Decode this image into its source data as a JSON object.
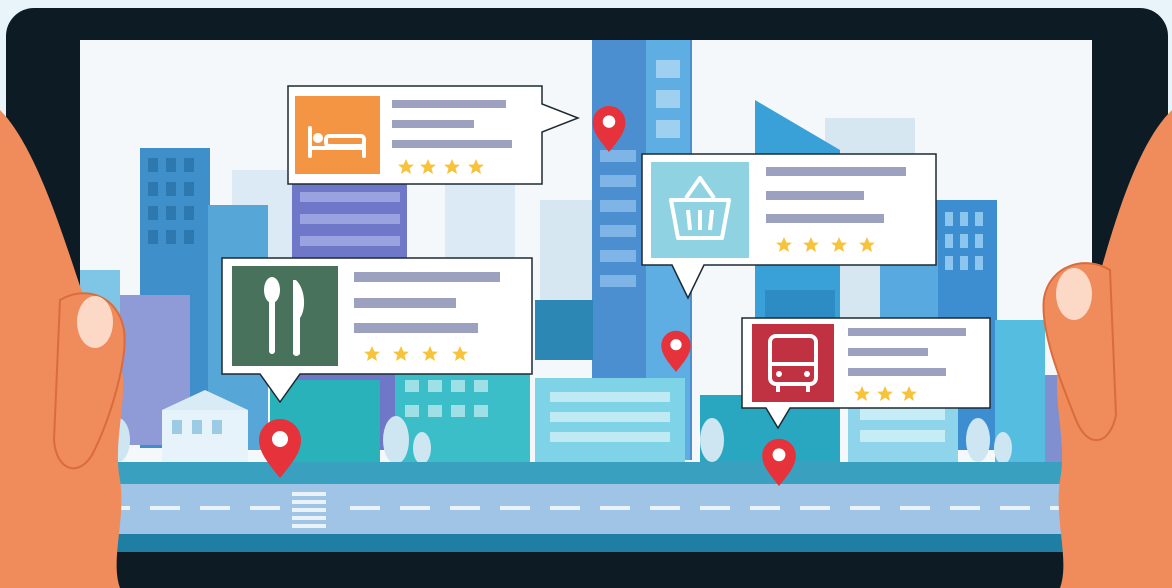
{
  "scene": {
    "title": "",
    "colors": {
      "frame": "#0d1b24",
      "sky": "#f4f8fb",
      "road": "#5aa9c6",
      "pin": "#e5323b",
      "star": "#f6c33a",
      "card_line": "#9ca1bf",
      "skin": "#f08b5b"
    }
  },
  "cards": [
    {
      "id": "hotel",
      "category": "hotel",
      "icon": "bed-icon",
      "icon_bg": "#f49543",
      "rating": 4
    },
    {
      "id": "shopping",
      "category": "shopping",
      "icon": "basket-icon",
      "icon_bg": "#8fd3e3",
      "rating": 4
    },
    {
      "id": "restaurant",
      "category": "restaurant",
      "icon": "fork-knife-icon",
      "icon_bg": "#48725b",
      "rating": 4
    },
    {
      "id": "transit",
      "category": "transit",
      "icon": "bus-icon",
      "icon_bg": "#c03242",
      "rating": 3
    }
  ],
  "pins": [
    {
      "id": "pin-1",
      "icon": "map-pin-icon"
    },
    {
      "id": "pin-2",
      "icon": "map-pin-icon"
    },
    {
      "id": "pin-3",
      "icon": "map-pin-icon"
    },
    {
      "id": "pin-4",
      "icon": "map-pin-icon"
    }
  ]
}
